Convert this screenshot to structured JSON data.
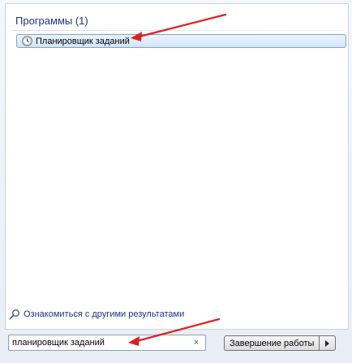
{
  "results": {
    "section_header": "Программы (1)",
    "items": [
      {
        "label": "Планировщик заданий",
        "icon": "clock-icon"
      }
    ]
  },
  "see_more": {
    "label": "Ознакомиться с другими результатами",
    "icon": "magnifier-icon"
  },
  "search": {
    "value": "планировщик заданий",
    "clear_icon": "×"
  },
  "shutdown": {
    "label": "Завершение работы",
    "arrow_icon": "arrow-right-icon"
  },
  "colors": {
    "header_text": "#1e3287",
    "highlight_border": "#7da2ce",
    "annotation_arrow": "#e01f1f"
  }
}
